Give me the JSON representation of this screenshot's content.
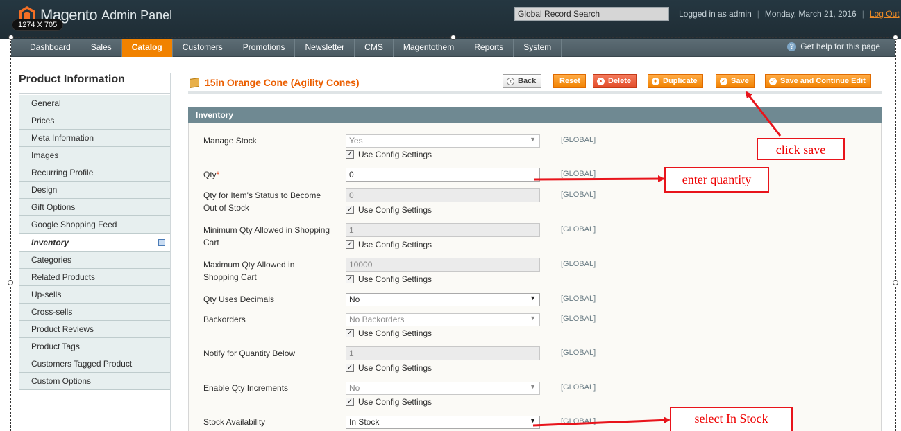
{
  "header": {
    "logo_name": "Magento",
    "logo_admin": "Admin Panel",
    "dim_badge": "1274 X 705",
    "search_value": "Global Record Search",
    "logged_in": "Logged in as admin",
    "date": "Monday, March 21, 2016",
    "logout": "Log Out"
  },
  "nav": {
    "items": [
      "Dashboard",
      "Sales",
      "Catalog",
      "Customers",
      "Promotions",
      "Newsletter",
      "CMS",
      "Magentothem",
      "Reports",
      "System"
    ],
    "help": "Get help for this page"
  },
  "sidebar": {
    "title": "Product Information",
    "items": [
      "General",
      "Prices",
      "Meta Information",
      "Images",
      "Recurring Profile",
      "Design",
      "Gift Options",
      "Google Shopping Feed",
      "Inventory",
      "Categories",
      "Related Products",
      "Up-sells",
      "Cross-sells",
      "Product Reviews",
      "Product Tags",
      "Customers Tagged Product",
      "Custom Options"
    ]
  },
  "page": {
    "title": "15in Orange Cone (Agility Cones)",
    "buttons": {
      "back": "Back",
      "reset": "Reset",
      "delete": "Delete",
      "duplicate": "Duplicate",
      "save": "Save",
      "save_continue": "Save and Continue Edit"
    }
  },
  "inventory": {
    "heading": "Inventory",
    "use_config": "Use Config Settings",
    "scope": "[GLOBAL]",
    "manage_stock": {
      "label": "Manage Stock",
      "value": "Yes"
    },
    "qty": {
      "label": "Qty",
      "value": "0"
    },
    "out_of_stock": {
      "label": "Qty for Item's Status to Become Out of Stock",
      "value": "0"
    },
    "min_qty": {
      "label": "Minimum Qty Allowed in Shopping Cart",
      "value": "1"
    },
    "max_qty": {
      "label": "Maximum Qty Allowed in Shopping Cart",
      "value": "10000"
    },
    "decimals": {
      "label": "Qty Uses Decimals",
      "value": "No"
    },
    "backorders": {
      "label": "Backorders",
      "value": "No Backorders"
    },
    "notify": {
      "label": "Notify for Quantity Below",
      "value": "1"
    },
    "increments": {
      "label": "Enable Qty Increments",
      "value": "No"
    },
    "stock_availability": {
      "label": "Stock Availability",
      "value": "In Stock"
    }
  },
  "annotations": {
    "click_save": "click save",
    "enter_quantity": "enter quantity",
    "select_in_stock": "select In Stock",
    "color": "#e8141b"
  }
}
